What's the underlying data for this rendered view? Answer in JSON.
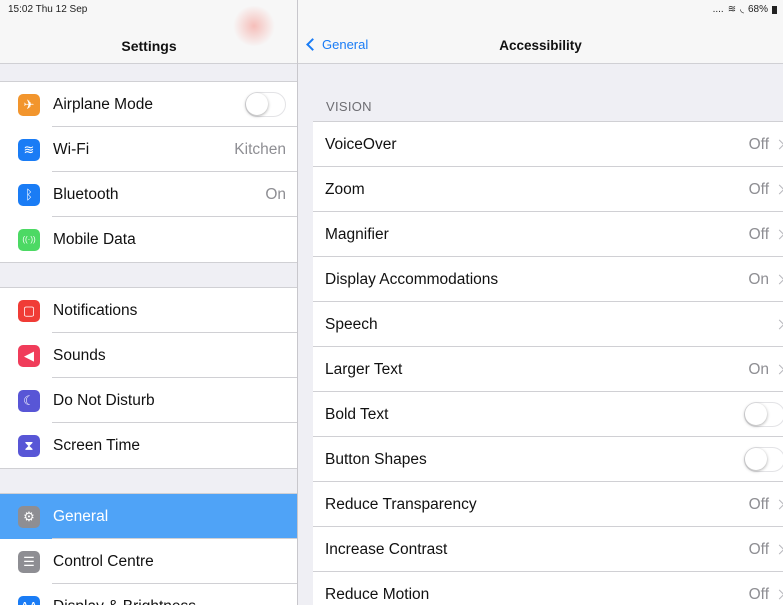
{
  "status": {
    "time": "15:02 Thu 12 Sep",
    "battery": "68%"
  },
  "left": {
    "title": "Settings",
    "group1": [
      {
        "label": "Airplane Mode",
        "icon": "airplane-icon",
        "glyph": "✈",
        "color": "#f2952d",
        "toggle": "off"
      },
      {
        "label": "Wi-Fi",
        "icon": "wifi-icon",
        "glyph": "≋",
        "color": "#1a7cf5",
        "value": "Kitchen"
      },
      {
        "label": "Bluetooth",
        "icon": "bluetooth-icon",
        "glyph": "ᛒ",
        "color": "#1a7cf5",
        "value": "On"
      },
      {
        "label": "Mobile Data",
        "icon": "antenna-icon",
        "glyph": "((·))",
        "color": "#4cd964"
      }
    ],
    "group2": [
      {
        "label": "Notifications",
        "icon": "notifications-icon",
        "glyph": "▢",
        "color": "#f03c36"
      },
      {
        "label": "Sounds",
        "icon": "speaker-icon",
        "glyph": "◀",
        "color": "#f03c5a"
      },
      {
        "label": "Do Not Disturb",
        "icon": "moon-icon",
        "glyph": "☾",
        "color": "#5856d6"
      },
      {
        "label": "Screen Time",
        "icon": "hourglass-icon",
        "glyph": "⧗",
        "color": "#5856d6"
      }
    ],
    "group3": [
      {
        "label": "General",
        "icon": "gear-icon",
        "glyph": "⚙",
        "color": "#8e8e93",
        "selected": true
      },
      {
        "label": "Control Centre",
        "icon": "control-centre-icon",
        "glyph": "☰",
        "color": "#8e8e93"
      },
      {
        "label": "Display & Brightness",
        "icon": "display-icon",
        "glyph": "AA",
        "color": "#1a7cf5"
      }
    ]
  },
  "right": {
    "back_label": "General",
    "title": "Accessibility",
    "section_header": "VISION",
    "rows": [
      {
        "label": "VoiceOver",
        "value": "Off",
        "type": "nav"
      },
      {
        "label": "Zoom",
        "value": "Off",
        "type": "nav"
      },
      {
        "label": "Magnifier",
        "value": "Off",
        "type": "nav"
      },
      {
        "label": "Display Accommodations",
        "value": "On",
        "type": "nav"
      },
      {
        "label": "Speech",
        "value": "",
        "type": "nav"
      },
      {
        "label": "Larger Text",
        "value": "On",
        "type": "nav"
      },
      {
        "label": "Bold Text",
        "type": "toggle",
        "toggle": "off"
      },
      {
        "label": "Button Shapes",
        "type": "toggle",
        "toggle": "off"
      },
      {
        "label": "Reduce Transparency",
        "value": "Off",
        "type": "nav"
      },
      {
        "label": "Increase Contrast",
        "value": "Off",
        "type": "nav"
      },
      {
        "label": "Reduce Motion",
        "value": "Off",
        "type": "nav"
      }
    ]
  }
}
